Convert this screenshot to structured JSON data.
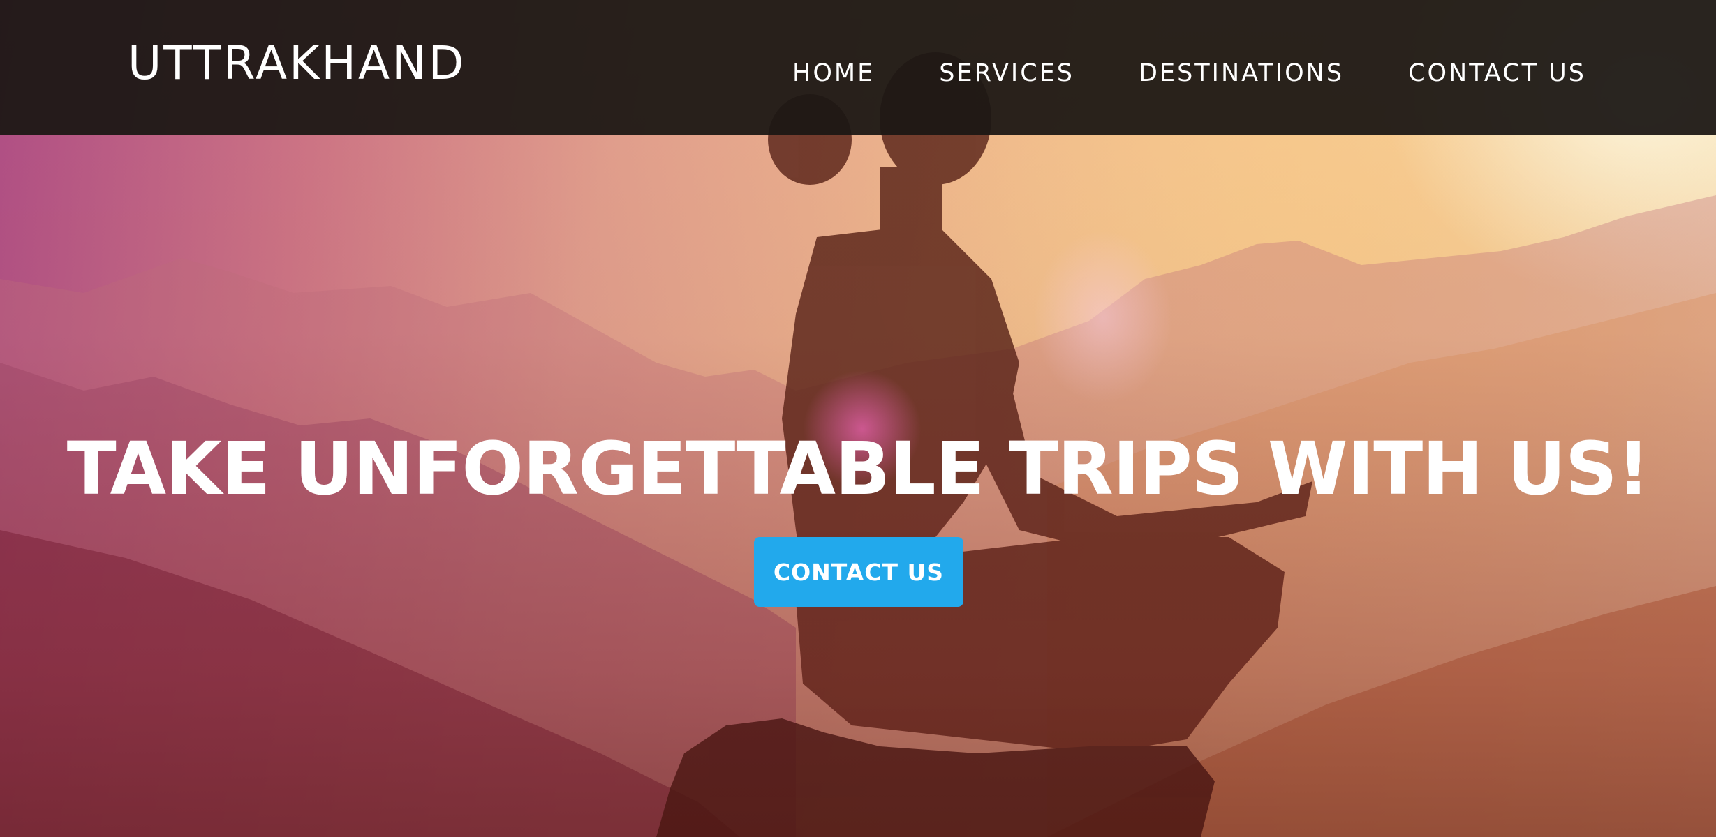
{
  "header": {
    "logo": "UTTRAKHAND",
    "nav": [
      {
        "label": "HOME"
      },
      {
        "label": "SERVICES"
      },
      {
        "label": "DESTINATIONS"
      },
      {
        "label": "CONTACT US"
      }
    ]
  },
  "hero": {
    "title": "TAKE UNFORGETTABLE TRIPS WITH US!",
    "cta_label": "CONTACT US",
    "image_subject": "meditating-person-silhouette-mountain-sunset"
  },
  "colors": {
    "header_bg": "#1c1714",
    "cta_bg": "#22a9ec",
    "text": "#ffffff"
  }
}
